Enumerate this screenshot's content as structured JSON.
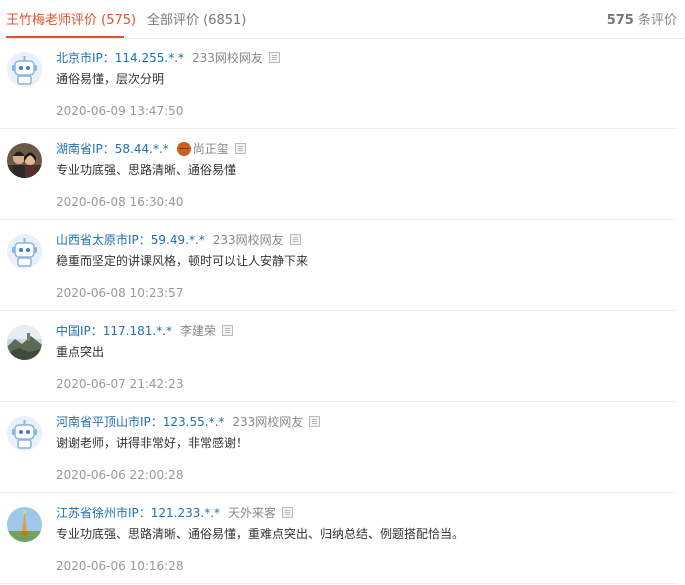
{
  "tabs": [
    {
      "label": "王竹梅老师评价 (575)",
      "active": true
    },
    {
      "label": "全部评价 (6851)",
      "active": false
    }
  ],
  "total": {
    "count": "575",
    "suffix": " 条评价"
  },
  "reviews": [
    {
      "location": "北京市IP：114.255.*.*",
      "nickname": "233网校网友",
      "text": "通俗易懂，层次分明",
      "time": "2020-06-09 13:47:50",
      "avatar": "robot-avatar",
      "badge": false
    },
    {
      "location": "湖南省IP：58.44.*.*",
      "nickname": "尚正玺",
      "text": "专业功底强、思路清晰、通俗易懂",
      "time": "2020-06-08 16:30:40",
      "avatar": "couple-photo-avatar",
      "badge": true
    },
    {
      "location": "山西省太原市IP：59.49.*.*",
      "nickname": "233网校网友",
      "text": "稳重而坚定的讲课风格，顿时可以让人安静下来",
      "time": "2020-06-08 10:23:57",
      "avatar": "robot-avatar",
      "badge": false
    },
    {
      "location": "中国IP：117.181.*.*",
      "nickname": "李建荣",
      "text": "重点突出",
      "time": "2020-06-07 21:42:23",
      "avatar": "landscape-photo-avatar",
      "badge": false
    },
    {
      "location": "河南省平顶山市IP：123.55.*.*",
      "nickname": "233网校网友",
      "text": "谢谢老师，讲得非常好，非常感谢！",
      "time": "2020-06-06 22:00:28",
      "avatar": "robot-avatar",
      "badge": false
    },
    {
      "location": "江苏省徐州市IP：121.233.*.*",
      "nickname": "天外来客",
      "text": "专业功底强、思路清晰、通俗易懂，重难点突出、归纳总结、例题搭配恰当。",
      "time": "2020-06-06 10:16:28",
      "avatar": "tower-photo-avatar",
      "badge": false
    }
  ],
  "colors": {
    "accent": "#e4512f",
    "link": "#1f6fb2",
    "muted": "#999999"
  }
}
